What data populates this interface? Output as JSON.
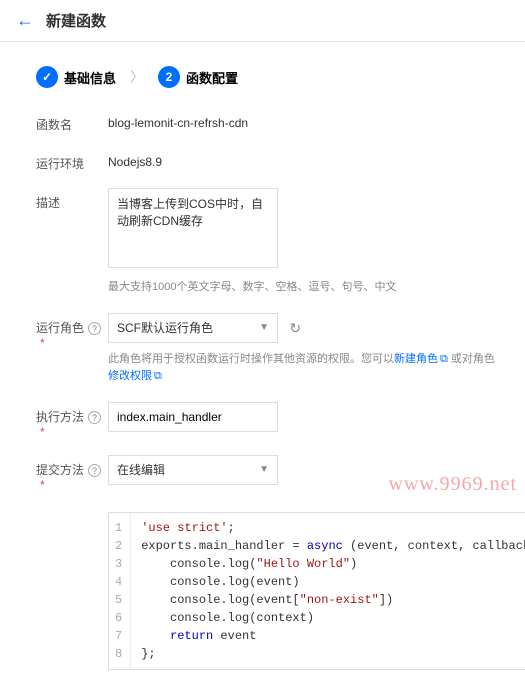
{
  "header": {
    "title": "新建函数"
  },
  "steps": {
    "s1": {
      "icon": "✓",
      "label": "基础信息"
    },
    "s2": {
      "icon": "2",
      "label": "函数配置"
    }
  },
  "labels": {
    "name": "函数名",
    "runtime": "运行环境",
    "desc": "描述",
    "role": "运行角色",
    "handler": "执行方法",
    "submit": "提交方法"
  },
  "values": {
    "name": "blog-lemonit-cn-refrsh-cdn",
    "runtime": "Nodejs8.9",
    "desc": "当博客上传到COS中时，自动刷新CDN缓存",
    "role": "SCF默认运行角色",
    "handler": "index.main_handler",
    "submit": "在线编辑"
  },
  "hints": {
    "desc": "最大支持1000个英文字母、数字、空格、逗号、句号、中文",
    "role_prefix": "此角色将用于授权函数运行时操作其他资源的权限。您可以",
    "role_link1": "新建角色",
    "role_mid": " 或对角色",
    "role_link2": "修改权限"
  },
  "code": {
    "l1a": "'use strict'",
    "l1b": ";",
    "l2a": "exports.main_handler = ",
    "l2kw": "async",
    "l2b": " (event, context, callback) => {",
    "l3a": "    console.log(",
    "l3s": "\"Hello World\"",
    "l3b": ")",
    "l4": "    console.log(event)",
    "l5a": "    console.log(event[",
    "l5s": "\"non-exist\"",
    "l5b": "])",
    "l6": "    console.log(context)",
    "l7a": "    ",
    "l7kw": "return",
    "l7b": " event",
    "l8": "};"
  },
  "watermark": "www.9969.net"
}
